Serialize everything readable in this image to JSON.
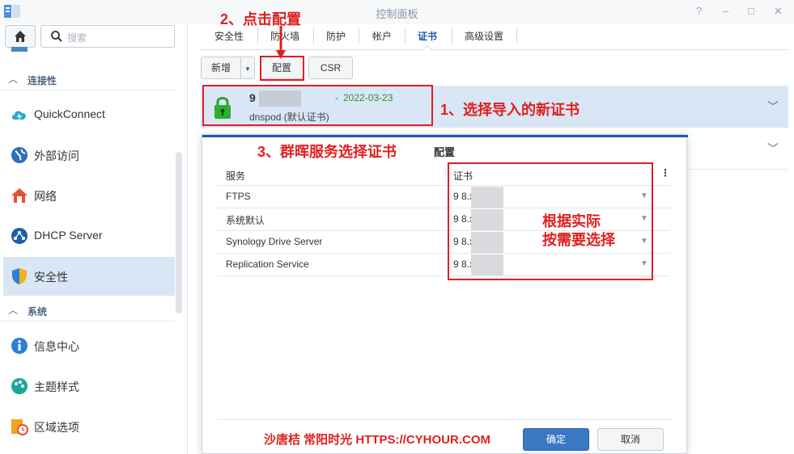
{
  "window": {
    "title": "控制面板",
    "controls": [
      "?",
      "–",
      "□",
      "✕"
    ]
  },
  "sidebar": {
    "search_placeholder": "搜索",
    "sections": [
      {
        "label": "连接性",
        "items": [
          "QuickConnect",
          "外部访问",
          "网络",
          "DHCP Server",
          "安全性"
        ]
      },
      {
        "label": "系统",
        "items": [
          "信息中心",
          "主题样式",
          "区域选项"
        ]
      }
    ],
    "active_item": "安全性"
  },
  "tabs": [
    "安全性",
    "防火墙",
    "防护",
    "帐户",
    "证书",
    "高级设置"
  ],
  "active_tab": "证书",
  "toolbar": {
    "add": "新增",
    "configure": "配置",
    "csr": "CSR"
  },
  "certificate": {
    "name": "9        8.xyz",
    "separator": "-",
    "date": "2022-03-23",
    "subtitle": "dnspod (默认证书)"
  },
  "dialog": {
    "title": "配置",
    "col_service": "服务",
    "col_certificate": "证书",
    "rows": [
      {
        "service": "FTPS",
        "certificate": "9        8.xyz"
      },
      {
        "service": "系统默认",
        "certificate": "9        8.xyz"
      },
      {
        "service": "Synology Drive Server",
        "certificate": "9        8.xyz"
      },
      {
        "service": "Replication Service",
        "certificate": "9        8.xyz"
      }
    ],
    "ok": "确定",
    "cancel": "取消"
  },
  "annotations": {
    "step1": "1、选择导入的新证书",
    "step2": "2、点击配置",
    "step3": "3、群晖服务选择证书",
    "note_line1": "根据实际",
    "note_line2": "按需要选择",
    "watermark": "沙唐桔 常阳时光 HTTPS://CYHOUR.COM"
  },
  "colors": {
    "accent": "#1e5aa8",
    "annotation": "#e02020",
    "selection": "#d9e6f5",
    "date": "#2f8f2f"
  }
}
